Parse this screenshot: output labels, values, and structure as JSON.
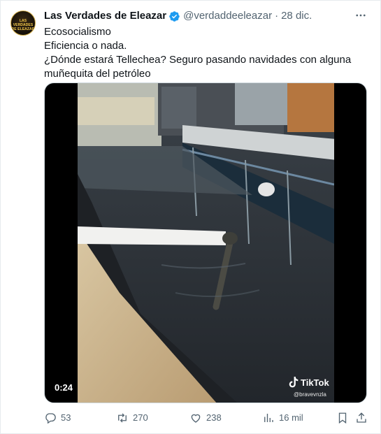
{
  "tweet": {
    "avatar_text": "LAS VERDADES DE ELEAZAR",
    "display_name": "Las Verdades de Eleazar",
    "handle": "@verdaddeeleazar",
    "separator": "·",
    "date": "28 dic.",
    "lines": [
      "Ecosocialismo",
      "Eficiencia o nada.",
      "¿Dónde estará Tellechea? Seguro pasando navidades con alguna",
      "muñequita del petróleo"
    ]
  },
  "video": {
    "time": "0:24",
    "watermark": "TikTok",
    "watermark_user": "@bravevnzla"
  },
  "actions": {
    "replies": "53",
    "retweets": "270",
    "likes": "238",
    "views": "16 mil"
  },
  "colors": {
    "verified": "#1d9bf0",
    "secondary_text": "#536471",
    "primary_text": "#0f1419"
  },
  "icons": [
    "verified-badge-icon",
    "more-icon",
    "reply-icon",
    "retweet-icon",
    "like-icon",
    "views-icon",
    "bookmark-icon",
    "share-icon",
    "tiktok-logo-icon"
  ]
}
